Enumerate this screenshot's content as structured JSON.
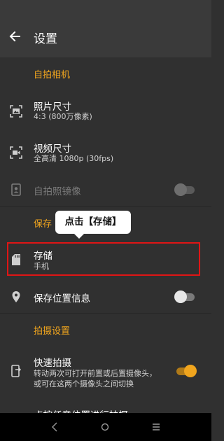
{
  "header": {
    "title": "设置"
  },
  "sections": {
    "selfie_camera": "自拍相机",
    "save_partial": "保存",
    "shooting_settings": "拍摄设置"
  },
  "rows": {
    "photo_size": {
      "title": "照片尺寸",
      "value": "4:3 (800万像素)"
    },
    "video_size": {
      "title": "视频尺寸",
      "value": "全高清 1080p (30fps)"
    },
    "selfie_mirror": {
      "title": "自拍照镜像",
      "enabled": false,
      "toggle_on": false
    },
    "storage": {
      "title": "存储",
      "value": "手机"
    },
    "save_location": {
      "title": "保存位置信息",
      "toggle_on": false
    },
    "quick_shoot": {
      "title": "快速拍摄",
      "description_line1": "转动两次可打开前置或后置摄像头，",
      "description_line2": "或可在这两个摄像头之间切换",
      "toggle_on": true
    },
    "tap_anywhere": {
      "title": "点按任意位置进行拍摄"
    }
  },
  "annotation": {
    "callout_text": "点击【存储】"
  },
  "colors": {
    "accent": "#f0a51e",
    "highlight": "#e01515",
    "background": "#303030",
    "appbar": "#3a3a3a"
  },
  "navbar": {
    "back_icon": "triangle-back-icon",
    "home_icon": "circle-home-icon",
    "menu_icon": "menu-lines-icon"
  }
}
